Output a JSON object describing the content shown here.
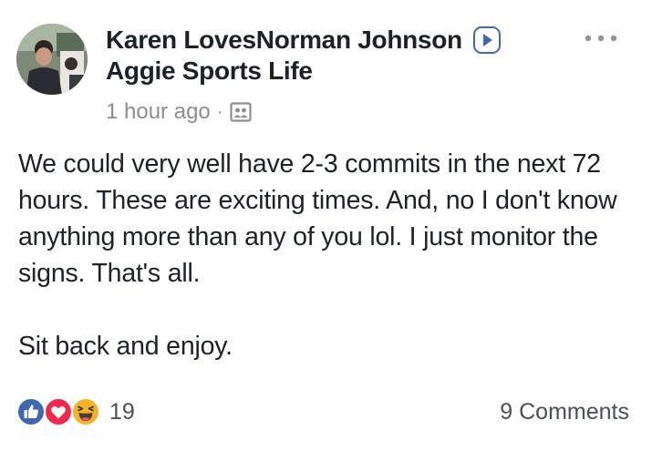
{
  "post": {
    "author": "Karen LovesNorman Johnson",
    "group": "Aggie Sports Life",
    "timestamp": "1 hour ago",
    "separator": "·",
    "body": [
      "We could very well have 2-3 commits in the next 72 hours.  These are exciting times. And, no I don't know anything more than any of you lol.  I just monitor the signs.  That's all.",
      "Sit back and enjoy."
    ],
    "reaction_count": "19",
    "comments_label": "9 Comments",
    "reaction_types": [
      "like-icon",
      "love-icon",
      "haha-icon"
    ],
    "icons": {
      "author_badge": "play-arrow-icon",
      "privacy": "group-members-icon",
      "more": "more-options-icon"
    },
    "colors": {
      "text": "#1d2129",
      "muted": "#8b8e93",
      "like_blue": "#4267b2",
      "love_red": "#f0284a",
      "haha_yellow": "#f7b125"
    }
  }
}
